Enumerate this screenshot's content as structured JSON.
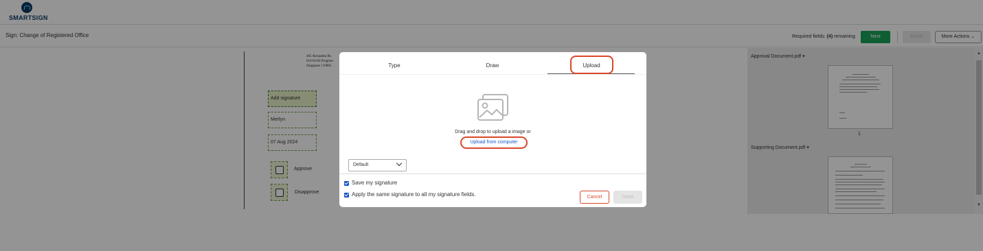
{
  "app": {
    "logo_text": "SMARTSIGN"
  },
  "header": {
    "title": "Sign: Change of Registered Office",
    "required_prefix": "Required fields: ",
    "required_count": "(4)",
    "required_suffix": " remaining",
    "next_label": "Next",
    "finish_label": "Finish",
    "more_actions_label": "More Actions"
  },
  "document": {
    "address_lines": [
      "465 Alexandra Ro",
      "#16-01/02 Progress",
      "Singapore 119002"
    ],
    "fields": {
      "signature_label": "Add signature",
      "name_value": "Merlyn",
      "date_value": "07 Aug 2024",
      "approve_label": "Approve",
      "disapprove_label": "Disapprove"
    }
  },
  "right_panel": {
    "documents": [
      {
        "title": "Approval Document.pdf",
        "page": "1"
      },
      {
        "title": "Supporting Document.pdf"
      }
    ]
  },
  "modal": {
    "tabs": [
      "Type",
      "Draw",
      "Upload"
    ],
    "active_tab": "Upload",
    "drop_text": "Drag and drop to upload a image or",
    "upload_link": "Upload from computer",
    "select_value": "Default",
    "save_signature_label": "Save my signature",
    "apply_all_label": "Apply the same signature to all my signature fields.",
    "cancel_label": "Cancel",
    "done_label": "Done"
  },
  "colors": {
    "accent_red": "#d9472b",
    "next_green": "#1aa35a",
    "link_blue": "#1a56c8"
  }
}
